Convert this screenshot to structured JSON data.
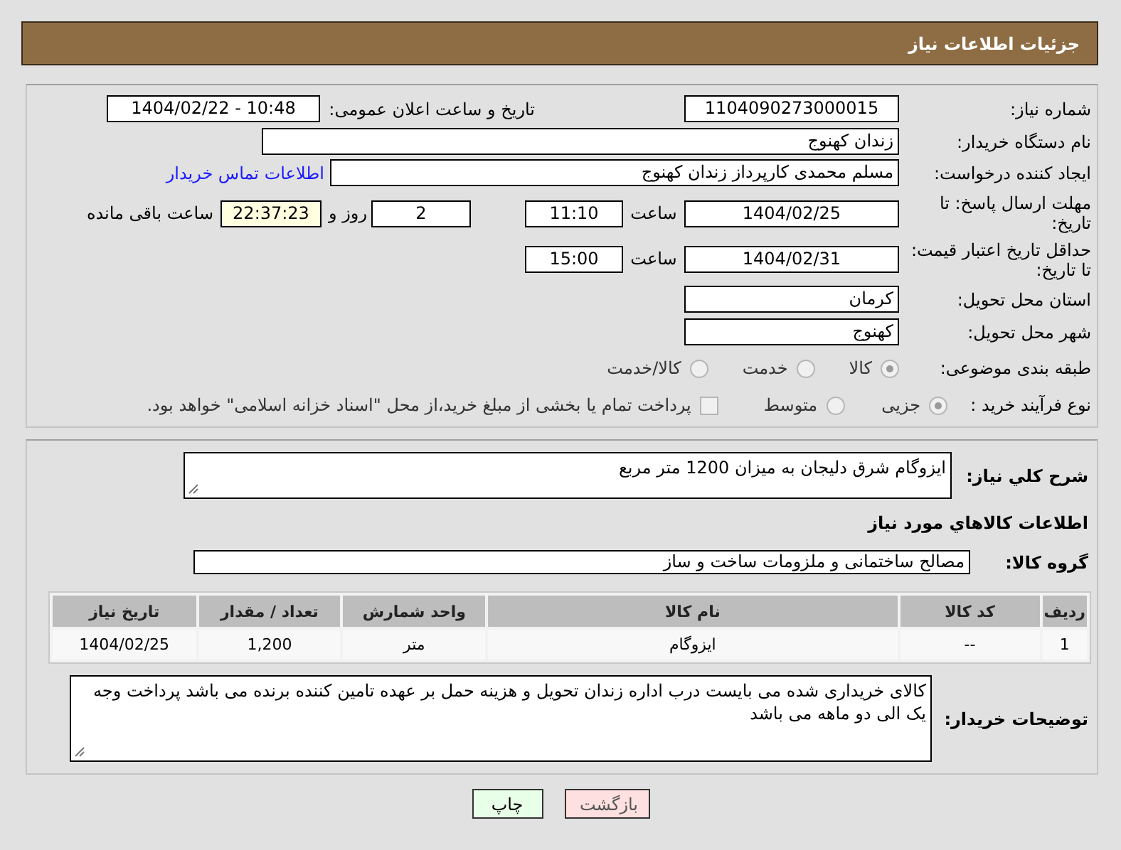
{
  "header": {
    "title": "جزئیات اطلاعات نیاز"
  },
  "details": {
    "need_number": {
      "label": "شماره نیاز:",
      "value": "1104090273000015"
    },
    "announce": {
      "label": "تاریخ و ساعت اعلان عمومی:",
      "value": "1404/02/22 - 10:48"
    },
    "buyer_org": {
      "label": "نام دستگاه خریدار:",
      "value": "زندان کهنوج"
    },
    "creator": {
      "label": "ایجاد کننده درخواست:",
      "value": "مسلم محمدی کارپرداز زندان کهنوج",
      "link": "اطلاعات تماس خریدار"
    },
    "deadline": {
      "label": "مهلت ارسال پاسخ: تا تاریخ:",
      "date": "1404/02/25",
      "time_label": "ساعت",
      "time": "11:10",
      "days": "2",
      "days_label": "روز و",
      "remaining": "22:37:23",
      "remaining_label": "ساعت باقی مانده"
    },
    "validity": {
      "label": "حداقل تاریخ اعتبار قیمت: تا تاریخ:",
      "date": "1404/02/31",
      "time_label": "ساعت",
      "time": "15:00"
    },
    "province": {
      "label": "استان محل تحویل:",
      "value": "کرمان"
    },
    "city": {
      "label": "شهر محل تحویل:",
      "value": "کهنوج"
    },
    "category": {
      "label": "طبقه بندی موضوعی:",
      "options": [
        {
          "label": "کالا",
          "selected": true
        },
        {
          "label": "خدمت",
          "selected": false
        },
        {
          "label": "کالا/خدمت",
          "selected": false
        }
      ]
    },
    "process": {
      "label": "نوع فرآیند خرید :",
      "options": [
        {
          "label": "جزیی",
          "selected": true
        },
        {
          "label": "متوسط",
          "selected": false
        }
      ],
      "treasury": {
        "label": "پرداخت تمام یا بخشی از مبلغ خرید،از محل \"اسناد خزانه اسلامی\" خواهد بود.",
        "checked": false
      }
    }
  },
  "goods": {
    "description": {
      "label": "شرح کلي نياز:",
      "value": "ایزوگام شرق دلیجان به میزان 1200 متر مربع"
    },
    "heading": "اطلاعات كالاهاي مورد نياز",
    "group": {
      "label": "گروه کالا:",
      "value": "مصالح ساختمانی و ملزومات ساخت و ساز"
    },
    "table": {
      "columns": [
        "ردیف",
        "کد کالا",
        "نام کالا",
        "واحد شمارش",
        "تعداد / مقدار",
        "تاریخ نیاز"
      ],
      "rows": [
        [
          "1",
          "--",
          "ایزوگام",
          "متر",
          "1,200",
          "1404/02/25"
        ]
      ]
    },
    "notes": {
      "label": "توضیحات خریدار:",
      "value": "کالای خریداری شده می بایست درب اداره زندان تحویل و هزینه حمل بر عهده تامین کننده برنده می باشد پرداخت وجه یک الی دو ماهه می باشد"
    }
  },
  "buttons": [
    {
      "kind": "back",
      "label": "بازگشت"
    },
    {
      "kind": "print",
      "label": "چاپ"
    }
  ]
}
